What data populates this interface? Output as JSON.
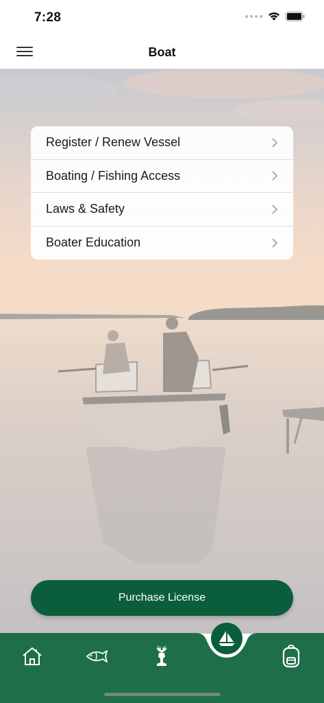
{
  "status_bar": {
    "time": "7:28"
  },
  "nav": {
    "title": "Boat"
  },
  "menu": {
    "items": [
      {
        "label": "Register / Renew Vessel"
      },
      {
        "label": "Boating / Fishing Access"
      },
      {
        "label": "Laws & Safety"
      },
      {
        "label": "Boater Education"
      }
    ]
  },
  "purchase": {
    "label": "Purchase License"
  },
  "tabs": [
    {
      "icon": "home-icon"
    },
    {
      "icon": "fish-icon"
    },
    {
      "icon": "deer-icon"
    },
    {
      "icon": "sailboat-icon",
      "active": true
    },
    {
      "icon": "backpack-icon"
    }
  ],
  "colors": {
    "brand_green": "#0b5e3c",
    "tab_bar_green": "#1e6e4a"
  }
}
